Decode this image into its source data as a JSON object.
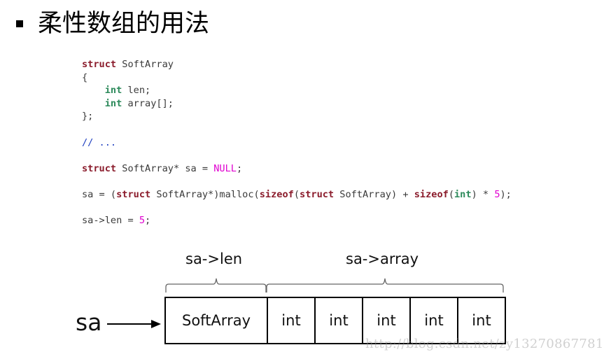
{
  "slide": {
    "title": "柔性数组的用法"
  },
  "code": {
    "lines": [
      [
        {
          "t": "struct",
          "c": "kw"
        },
        {
          "t": " SoftArray",
          "c": ""
        }
      ],
      [
        {
          "t": "{",
          "c": ""
        }
      ],
      [
        {
          "t": "    ",
          "c": ""
        },
        {
          "t": "int",
          "c": "ty"
        },
        {
          "t": " len;",
          "c": ""
        }
      ],
      [
        {
          "t": "    ",
          "c": ""
        },
        {
          "t": "int",
          "c": "ty"
        },
        {
          "t": " array[];",
          "c": ""
        }
      ],
      [
        {
          "t": "};",
          "c": ""
        }
      ],
      [],
      [
        {
          "t": "// ...",
          "c": "cm"
        }
      ],
      [],
      [
        {
          "t": "struct",
          "c": "kw"
        },
        {
          "t": " SoftArray* sa = ",
          "c": ""
        },
        {
          "t": "NULL",
          "c": "num"
        },
        {
          "t": ";",
          "c": ""
        }
      ],
      [],
      [
        {
          "t": "sa = (",
          "c": ""
        },
        {
          "t": "struct",
          "c": "kw"
        },
        {
          "t": " SoftArray*)malloc(",
          "c": ""
        },
        {
          "t": "sizeof",
          "c": "kw"
        },
        {
          "t": "(",
          "c": ""
        },
        {
          "t": "struct",
          "c": "kw"
        },
        {
          "t": " SoftArray) + ",
          "c": ""
        },
        {
          "t": "sizeof",
          "c": "kw"
        },
        {
          "t": "(",
          "c": ""
        },
        {
          "t": "int",
          "c": "ty"
        },
        {
          "t": ") * ",
          "c": ""
        },
        {
          "t": "5",
          "c": "num"
        },
        {
          "t": ");",
          "c": ""
        }
      ],
      [],
      [
        {
          "t": "sa->len = ",
          "c": ""
        },
        {
          "t": "5",
          "c": "num"
        },
        {
          "t": ";",
          "c": ""
        }
      ]
    ]
  },
  "diagram": {
    "pointer_label": "sa",
    "len_label": "sa->len",
    "array_label": "sa->array",
    "head_cell": "SoftArray",
    "array_cells": [
      "int",
      "int",
      "int",
      "int",
      "int"
    ]
  },
  "watermark": "http://blog.csdn.net/zy13270867781",
  "colors": {
    "keyword": "#8b1c2c",
    "type": "#2d8a5b",
    "number": "#e000d0",
    "comment": "#2040c0"
  }
}
